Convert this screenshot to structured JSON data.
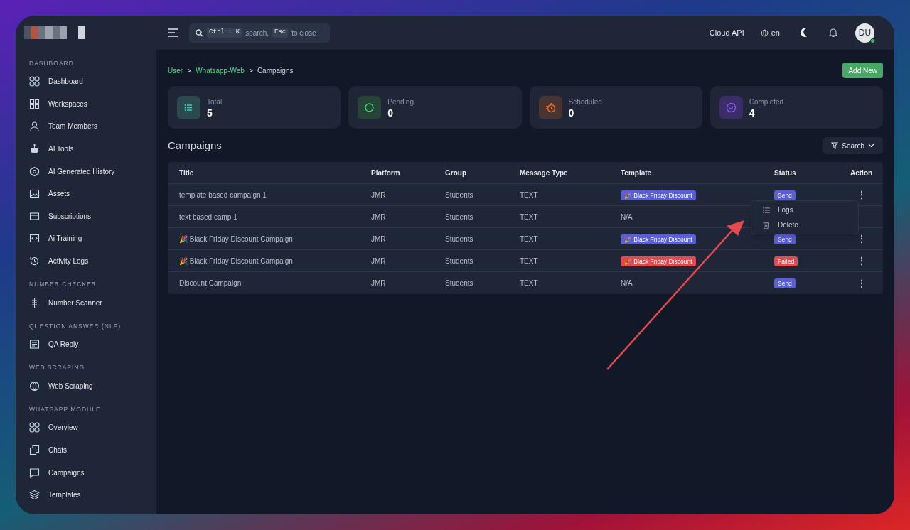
{
  "topbar": {
    "search": {
      "shortcut_key": "Ctrl + K",
      "shortcut_text": "search,",
      "escape_key": "Esc",
      "escape_text": "to close"
    },
    "api_label": "Cloud API",
    "language": "en",
    "avatar": "DU"
  },
  "sidebar": {
    "sections": [
      {
        "heading": "DASHBOARD",
        "items": [
          "Dashboard",
          "Workspaces",
          "Team Members",
          "AI Tools",
          "AI Generated History",
          "Assets",
          "Subscriptions",
          "Ai Training",
          "Activity Logs"
        ]
      },
      {
        "heading": "NUMBER CHECKER",
        "items": [
          "Number Scanner"
        ]
      },
      {
        "heading": "QUESTION ANSWER (NLP)",
        "items": [
          "QA Reply"
        ]
      },
      {
        "heading": "WEB SCRAPING",
        "items": [
          "Web Scraping"
        ]
      },
      {
        "heading": "WHATSAPP MODULE",
        "items": [
          "Overview",
          "Chats",
          "Campaigns",
          "Templates"
        ]
      }
    ]
  },
  "breadcrumb": {
    "links": [
      "User",
      "Whatsapp-Web"
    ],
    "current": "Campaigns"
  },
  "add_button": "Add New",
  "stats": [
    {
      "label": "Total",
      "value": "5"
    },
    {
      "label": "Pending",
      "value": "0"
    },
    {
      "label": "Scheduled",
      "value": "0"
    },
    {
      "label": "Completed",
      "value": "4"
    }
  ],
  "section_title": "Campaigns",
  "filter_button": "Search",
  "table": {
    "columns": [
      "Title",
      "Platform",
      "Group",
      "Message Type",
      "Template",
      "Status",
      "Action"
    ],
    "rows": [
      {
        "title": "template based campaign 1",
        "platform": "JMR",
        "group": "Students",
        "message_type": "TEXT",
        "template": {
          "text": "🎉 Black Friday Discount",
          "color": "#5b5fd6"
        },
        "status": {
          "text": "Send",
          "color": "#5b5fd6"
        },
        "action": "⋮"
      },
      {
        "title": "text based camp 1",
        "platform": "JMR",
        "group": "Students",
        "message_type": "TEXT",
        "template": {
          "text": "N/A"
        }
      },
      {
        "title": "🎉 Black Friday Discount Campaign",
        "platform": "JMR",
        "group": "Students",
        "message_type": "TEXT",
        "template": {
          "text": "🎉 Black Friday Discount",
          "color": "#5b5fd6"
        },
        "status": {
          "text": "Send",
          "color": "#5b5fd6"
        },
        "action": "⋮"
      },
      {
        "title": "🎉 Black Friday Discount Campaign",
        "platform": "JMR",
        "group": "Students",
        "message_type": "TEXT",
        "template": {
          "text": "🎉 Black Friday Discount",
          "color": "#e5484d"
        },
        "status": {
          "text": "Failed",
          "color": "#e5484d"
        },
        "action": "⋮"
      },
      {
        "title": "Discount Campaign",
        "platform": "JMR",
        "group": "Students",
        "message_type": "TEXT",
        "template": {
          "text": "N/A"
        },
        "status": {
          "text": "Send",
          "color": "#5b5fd6"
        },
        "action": "⋮"
      }
    ]
  },
  "action_menu": [
    "Logs",
    "Delete"
  ]
}
